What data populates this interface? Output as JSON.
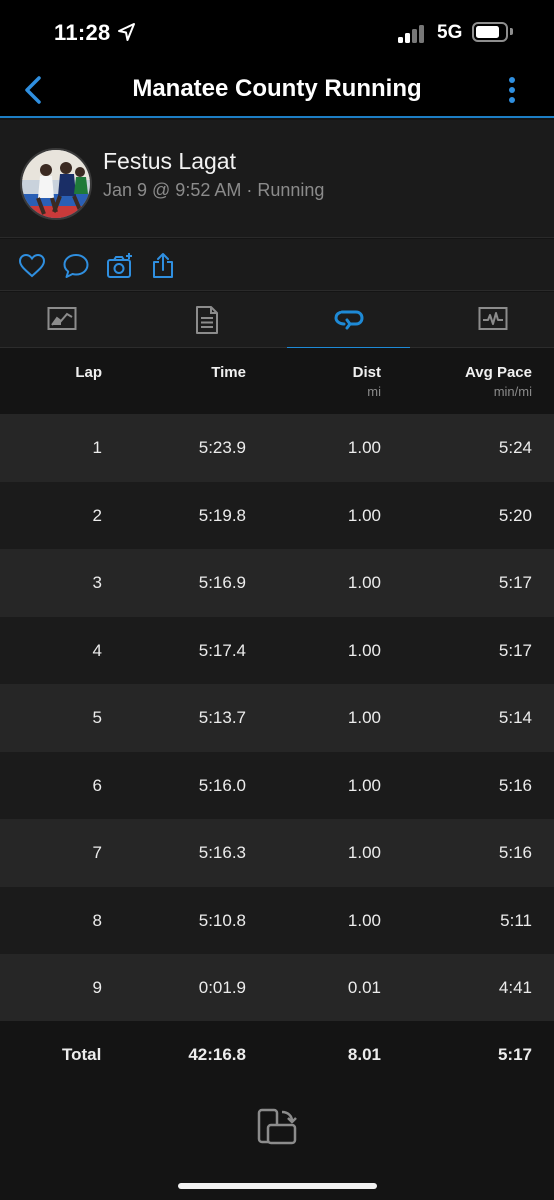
{
  "status_bar": {
    "time": "11:28",
    "network": "5G"
  },
  "nav": {
    "title": "Manatee County Running"
  },
  "activity": {
    "user_name": "Festus Lagat",
    "meta": "Jan 9 @ 9:52 AM · Running"
  },
  "actions": [
    "heart-icon",
    "comment-icon",
    "add-photo-icon",
    "share-icon"
  ],
  "tabs": [
    {
      "icon": "overview-icon",
      "active": false
    },
    {
      "icon": "details-icon",
      "active": false
    },
    {
      "icon": "laps-icon",
      "active": true
    },
    {
      "icon": "charts-icon",
      "active": false
    }
  ],
  "table": {
    "headers": {
      "lap": "Lap",
      "time": "Time",
      "dist": "Dist",
      "dist_unit": "mi",
      "pace": "Avg Pace",
      "pace_unit": "min/mi"
    },
    "rows": [
      {
        "lap": "1",
        "time": "5:23.9",
        "dist": "1.00",
        "pace": "5:24"
      },
      {
        "lap": "2",
        "time": "5:19.8",
        "dist": "1.00",
        "pace": "5:20"
      },
      {
        "lap": "3",
        "time": "5:16.9",
        "dist": "1.00",
        "pace": "5:17"
      },
      {
        "lap": "4",
        "time": "5:17.4",
        "dist": "1.00",
        "pace": "5:17"
      },
      {
        "lap": "5",
        "time": "5:13.7",
        "dist": "1.00",
        "pace": "5:14"
      },
      {
        "lap": "6",
        "time": "5:16.0",
        "dist": "1.00",
        "pace": "5:16"
      },
      {
        "lap": "7",
        "time": "5:16.3",
        "dist": "1.00",
        "pace": "5:16"
      },
      {
        "lap": "8",
        "time": "5:10.8",
        "dist": "1.00",
        "pace": "5:11"
      },
      {
        "lap": "9",
        "time": "0:01.9",
        "dist": "0.01",
        "pace": "4:41"
      }
    ],
    "total": {
      "label": "Total",
      "time": "42:16.8",
      "dist": "8.01",
      "pace": "5:17"
    }
  },
  "colors": {
    "accent": "#1e8ad6",
    "background": "#141414",
    "row_alt": "#262626"
  }
}
